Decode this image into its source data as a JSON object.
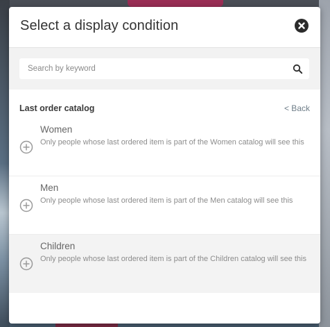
{
  "modal": {
    "title": "Select a display condition"
  },
  "search": {
    "placeholder": "Search by keyword",
    "value": ""
  },
  "section": {
    "title": "Last order catalog",
    "back_label": "< Back"
  },
  "options": [
    {
      "name": "Women",
      "description": "Only people whose last ordered item is part of the Women catalog will see this"
    },
    {
      "name": "Men",
      "description": "Only people whose last ordered item is part of the Men catalog will see this"
    },
    {
      "name": "Children",
      "description": "Only people whose last ordered item is part of the Children catalog will see this"
    }
  ],
  "icons": {
    "close": "close-icon",
    "search": "search-icon",
    "add": "plus-circle-icon"
  },
  "colors": {
    "title_text": "#333333",
    "muted_text": "#8c8c8c",
    "link": "#6e7d88",
    "search_band": "#f2f2f2",
    "hover_row": "#f3f3f3"
  }
}
